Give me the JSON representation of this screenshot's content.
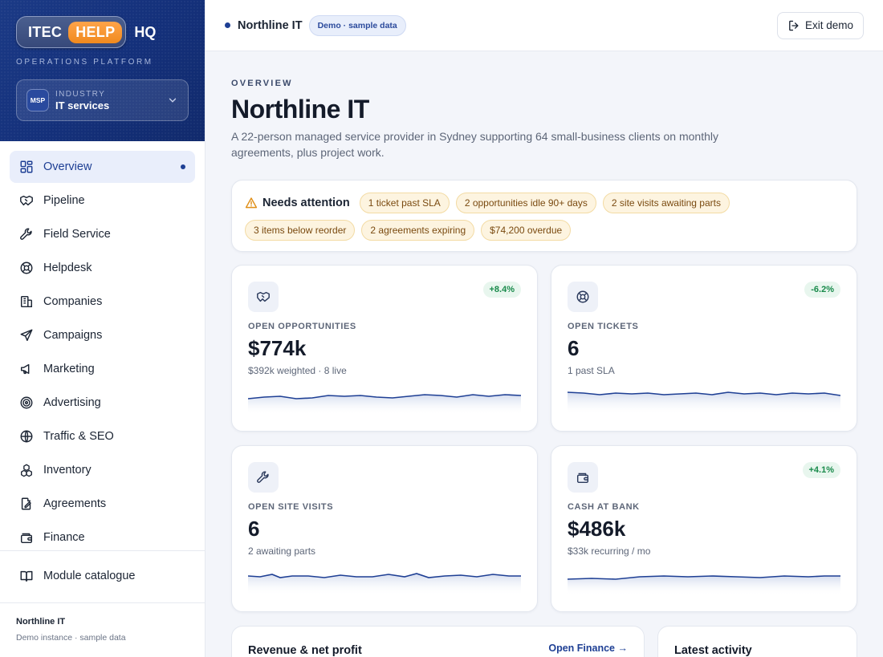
{
  "brand": {
    "itec": "ITEC",
    "help": "HELP",
    "hq": "HQ",
    "tagline": "OPERATIONS PLATFORM"
  },
  "industry": {
    "badge": "MSP",
    "caption": "INDUSTRY",
    "value": "IT services"
  },
  "sidebar": {
    "items": [
      {
        "label": "Overview",
        "icon": "grid-icon",
        "active": true
      },
      {
        "label": "Pipeline",
        "icon": "handshake-icon"
      },
      {
        "label": "Field Service",
        "icon": "wrench-icon"
      },
      {
        "label": "Helpdesk",
        "icon": "lifebuoy-icon"
      },
      {
        "label": "Companies",
        "icon": "building-icon"
      },
      {
        "label": "Campaigns",
        "icon": "send-icon"
      },
      {
        "label": "Marketing",
        "icon": "megaphone-icon"
      },
      {
        "label": "Advertising",
        "icon": "target-icon"
      },
      {
        "label": "Traffic & SEO",
        "icon": "globe-icon"
      },
      {
        "label": "Inventory",
        "icon": "boxes-icon"
      },
      {
        "label": "Agreements",
        "icon": "file-edit-icon"
      },
      {
        "label": "Finance",
        "icon": "wallet-icon"
      }
    ],
    "catalogue": "Module catalogue",
    "footer_title": "Northline IT",
    "footer_sub": "Demo instance · sample data"
  },
  "topbar": {
    "company": "Northline IT",
    "badge": "Demo · sample data",
    "exit": "Exit demo"
  },
  "page": {
    "eyebrow": "OVERVIEW",
    "title": "Northline IT",
    "description": "A 22-person managed service provider in Sydney supporting 64 small-business clients on monthly agreements, plus project work."
  },
  "attention": {
    "label": "Needs attention",
    "chips": [
      "1 ticket past SLA",
      "2 opportunities idle 90+ days",
      "2 site visits awaiting parts",
      "3 items below reorder",
      "2 agreements expiring",
      "$74,200 overdue"
    ]
  },
  "kpis": [
    {
      "label": "OPEN OPPORTUNITIES",
      "value": "$774k",
      "sub": "$392k weighted · 8 live",
      "delta": "+8.4%",
      "icon": "handshake-icon"
    },
    {
      "label": "OPEN TICKETS",
      "value": "6",
      "sub": "1 past SLA",
      "delta": "-6.2%",
      "icon": "lifebuoy-icon"
    },
    {
      "label": "OPEN SITE VISITS",
      "value": "6",
      "sub": "2 awaiting parts",
      "delta": "",
      "icon": "wrench-icon"
    },
    {
      "label": "CASH AT BANK",
      "value": "$486k",
      "sub": "$33k recurring / mo",
      "delta": "+4.1%",
      "icon": "wallet-icon"
    }
  ],
  "panels": {
    "revenue_title": "Revenue & net profit",
    "revenue_link": "Open Finance →",
    "activity_title": "Latest activity"
  },
  "colors": {
    "accent": "#1e3f94",
    "brand_bg": "#14307a",
    "help_orange": "#f08a1e",
    "positive": "#188a4a",
    "warning_chip": "#fdf4e0"
  }
}
